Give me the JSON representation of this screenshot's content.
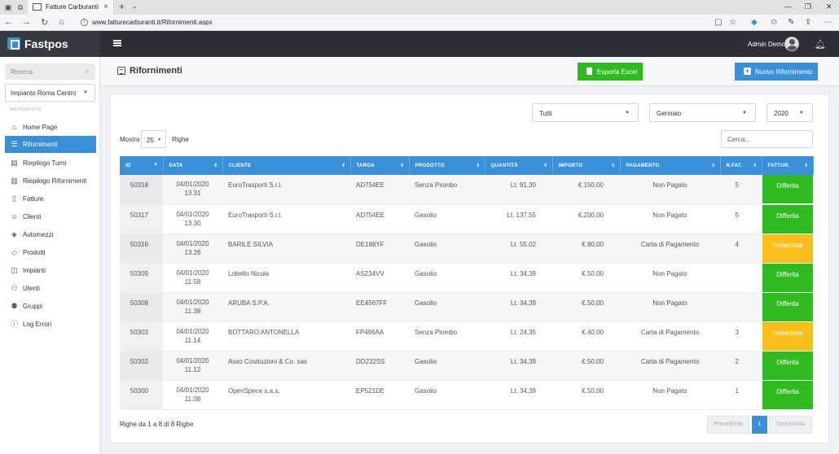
{
  "browser": {
    "tab_title": "Fatture Carburanti",
    "url": "www.fatturecarburanti.it/Rifornimenti.aspx"
  },
  "app": {
    "brand": "Fastpos",
    "user_name": "Admin Demo"
  },
  "sidebar": {
    "search_placeholder": "Ricerca",
    "plant_selected": "Impianto Roma Centro",
    "nav_heading": "NAVIGAZIONE",
    "items": [
      {
        "label": "Home Page",
        "icon": "home-icon"
      },
      {
        "label": "Rifornimenti",
        "icon": "list-icon",
        "active": true
      },
      {
        "label": "Riepilogo Turni",
        "icon": "document-icon"
      },
      {
        "label": "Riepilogo Rifornimenti",
        "icon": "book-icon"
      },
      {
        "label": "Fatture",
        "icon": "file-icon"
      },
      {
        "label": "Clienti",
        "icon": "user-icon"
      },
      {
        "label": "Automezzi",
        "icon": "layers-icon"
      },
      {
        "label": "Prodotti",
        "icon": "tag-icon"
      },
      {
        "label": "Impianti",
        "icon": "columns-icon"
      },
      {
        "label": "Utenti",
        "icon": "users-icon"
      },
      {
        "label": "Gruppi",
        "icon": "group-icon"
      },
      {
        "label": "Log Errori",
        "icon": "info-icon"
      }
    ]
  },
  "page": {
    "title": "Rifornimenti",
    "export_label": "Esporta Excel",
    "new_label": "Nuovo Rifornimento"
  },
  "filters": {
    "status": "Tutti",
    "month": "Gennaio",
    "year": "2020"
  },
  "table_controls": {
    "show_label": "Mostra",
    "page_length": "25",
    "rows_label": "Righe",
    "search_placeholder": "Cerca..."
  },
  "columns": [
    "ID",
    "DATA",
    "CLIENTE",
    "TARGA",
    "PRODOTTO",
    "QUANTITÀ",
    "IMPORTO",
    "PAGAMENTO",
    "N.FAT.",
    "FATTUR."
  ],
  "rows": [
    {
      "id": "50318",
      "date": "04/01/2020",
      "time": "13.31",
      "cliente": "EuroTrasporti S.r.l.",
      "targa": "AD754EE",
      "prodotto": "Senza Piombo",
      "quantita": "Lt. 91,30",
      "importo": "€.150,00",
      "pagamento": "Non Pagato",
      "nfat": "5",
      "fatt": "Differita",
      "fatt_color": "#2fbb1f"
    },
    {
      "id": "50317",
      "date": "04/01/2020",
      "time": "13.30",
      "cliente": "EuroTrasporti S.r.l.",
      "targa": "AD754EE",
      "prodotto": "Gasolio",
      "quantita": "Lt. 137,55",
      "importo": "€.200,00",
      "pagamento": "Non Pagato",
      "nfat": "5",
      "fatt": "Differita",
      "fatt_color": "#2fbb1f"
    },
    {
      "id": "50316",
      "date": "04/01/2020",
      "time": "13.26",
      "cliente": "BARILE SILVIA",
      "targa": "DE188YF",
      "prodotto": "Gasolio",
      "quantita": "Lt. 55,02",
      "importo": "€.80,00",
      "pagamento": "Carta di Pagamento",
      "nfat": "4",
      "fatt": "Immediata",
      "fatt_color": "#f8be1b"
    },
    {
      "id": "50309",
      "date": "04/01/2020",
      "time": "11.58",
      "cliente": "Lobello Nicola",
      "targa": "AS234VV",
      "prodotto": "Gasolio",
      "quantita": "Lt. 34,39",
      "importo": "€.50,00",
      "pagamento": "Non Pagato",
      "nfat": "",
      "fatt": "Differita",
      "fatt_color": "#2fbb1f"
    },
    {
      "id": "50308",
      "date": "04/01/2020",
      "time": "11.38",
      "cliente": "ARUBA S.P.A.",
      "targa": "EE4567FF",
      "prodotto": "Gasolio",
      "quantita": "Lt. 34,39",
      "importo": "€.50,00",
      "pagamento": "Non Pagato",
      "nfat": "",
      "fatt": "Differita",
      "fatt_color": "#2fbb1f"
    },
    {
      "id": "50303",
      "date": "04/01/2020",
      "time": "11.14",
      "cliente": "BOTTARO ANTONELLA",
      "targa": "FP496AA",
      "prodotto": "Senza Piombo",
      "quantita": "Lt. 24,35",
      "importo": "€.40,00",
      "pagamento": "Carta di Pagamento",
      "nfat": "3",
      "fatt": "Immediata",
      "fatt_color": "#f8be1b"
    },
    {
      "id": "50302",
      "date": "04/01/2020",
      "time": "11.12",
      "cliente": "Asso Costruzioni & Co. sas",
      "targa": "DD232SS",
      "prodotto": "Gasolio",
      "quantita": "Lt. 34,39",
      "importo": "€.50,00",
      "pagamento": "Carta di Pagamento",
      "nfat": "2",
      "fatt": "Differita",
      "fatt_color": "#2fbb1f"
    },
    {
      "id": "50300",
      "date": "04/01/2020",
      "time": "11.08",
      "cliente": "OpenSpece s.a.s.",
      "targa": "EP521DE",
      "prodotto": "Gasolio",
      "quantita": "Lt. 34,39",
      "importo": "€.50,00",
      "pagamento": "Non Pagato",
      "nfat": "1",
      "fatt": "Differita",
      "fatt_color": "#2fbb1f"
    }
  ],
  "footer": {
    "info": "Righe da 1 a 8 di 8 Righe",
    "prev": "Precedente",
    "page": "1",
    "next": "Successiva"
  }
}
